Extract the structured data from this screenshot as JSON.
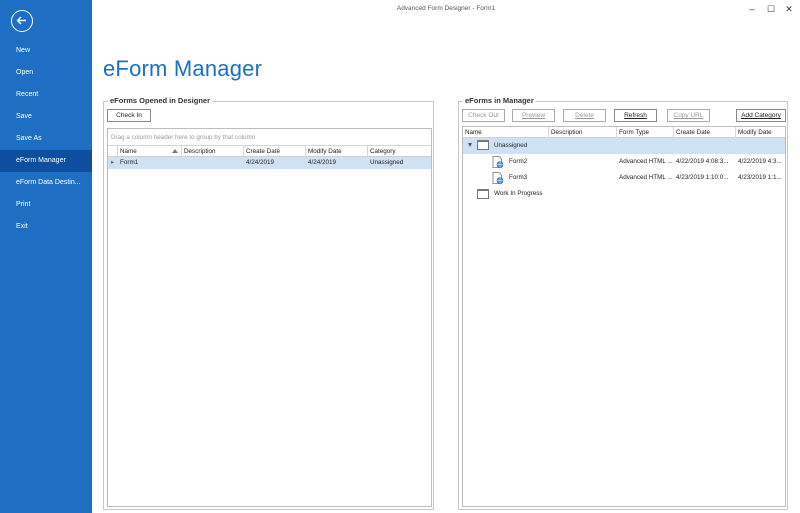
{
  "window": {
    "title": "Advanced Form Designer - Form1",
    "minimize": "–",
    "maximize": "☐",
    "close": "✕"
  },
  "sidebar": {
    "items": [
      {
        "label": "New",
        "active": false
      },
      {
        "label": "Open",
        "active": false
      },
      {
        "label": "Recent",
        "active": false
      },
      {
        "label": "Save",
        "active": false
      },
      {
        "label": "Save As",
        "active": false
      },
      {
        "label": "eForm Manager",
        "active": true
      },
      {
        "label": "eForm Data Destin...",
        "active": false
      },
      {
        "label": "Print",
        "active": false
      },
      {
        "label": "Exit",
        "active": false
      }
    ]
  },
  "page_title": "eForm Manager",
  "designer": {
    "caption": "eForms Opened in Designer",
    "check_in": "Check In",
    "group_hint": "Drag a column header here to group by that column",
    "columns": [
      "Name",
      "Description",
      "Create Date",
      "Modify Date",
      "Category"
    ],
    "rows": [
      {
        "name": "Form1",
        "description": "",
        "create_date": "4/24/2019",
        "modify_date": "4/24/2019",
        "category": "Unassigned"
      }
    ]
  },
  "manager": {
    "caption": "eForms in Manager",
    "buttons": {
      "check_out": "Check Out",
      "preview": "Preview",
      "delete": "Delete",
      "refresh": "Refresh",
      "copy_url": "Copy URL",
      "add_category": "Add Category"
    },
    "columns": [
      "Name",
      "Description",
      "Form Type",
      "Create Date",
      "Modify Date"
    ],
    "tree": {
      "category_unassigned": "Unassigned",
      "forms": [
        {
          "name": "Form2",
          "form_type": "Advanced HTML ...",
          "create_date": "4/22/2019 4:08:3...",
          "modify_date": "4/22/2019 4:3..."
        },
        {
          "name": "Form3",
          "form_type": "Advanced HTML ...",
          "create_date": "4/23/2019 1:10:0...",
          "modify_date": "4/23/2019 1:1..."
        }
      ],
      "category_wip": "Work In Progress"
    }
  },
  "colors": {
    "accent": "#1e6fc4",
    "active_nav": "#0d4f9e",
    "selection": "#cfe1f5"
  }
}
